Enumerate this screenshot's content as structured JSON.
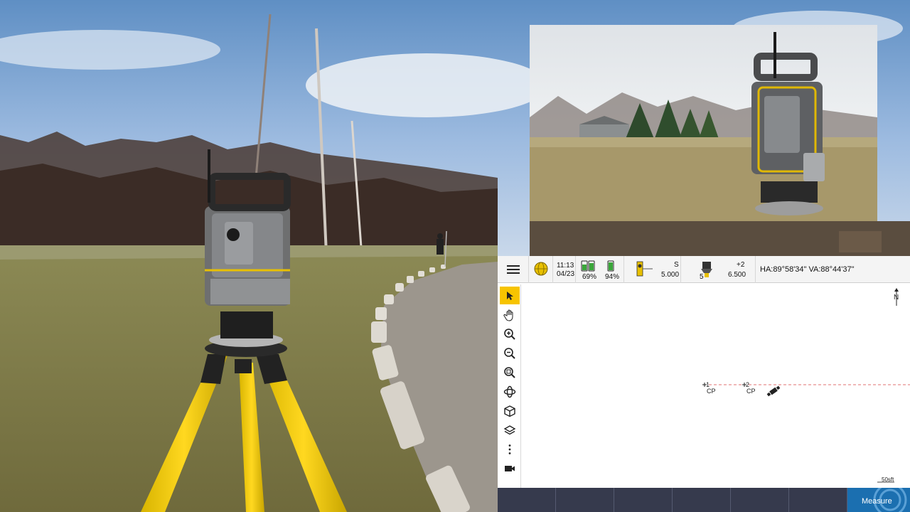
{
  "status_bar": {
    "time": "11:13",
    "date": "04/23",
    "controller_battery": "69%",
    "instrument_battery": "94%",
    "target_mode": "S",
    "target_height": "5.000",
    "prism_constant": "+2",
    "instrument_height": "6.500",
    "target_number": "5",
    "angles": "HA:89°58'34\"   VA:88°44'37\""
  },
  "map": {
    "points": [
      {
        "id": "1",
        "code": "CP"
      },
      {
        "id": "2",
        "code": "CP"
      }
    ],
    "north_label": "N",
    "scale_label": "50sft"
  },
  "toolbar": {
    "tools": [
      "select-icon",
      "pan-icon",
      "zoom-in-icon",
      "zoom-out-icon",
      "zoom-extents-icon",
      "orbit-icon",
      "3d-view-icon",
      "layers-icon",
      "more-icon",
      "video-icon"
    ]
  },
  "bottom_bar": {
    "measure_label": "Measure"
  },
  "colors": {
    "active_tool": "#f7c400",
    "bottom_bar": "#363a4d",
    "measure_button": "#1b6fb0",
    "baseline": "#e07070"
  }
}
